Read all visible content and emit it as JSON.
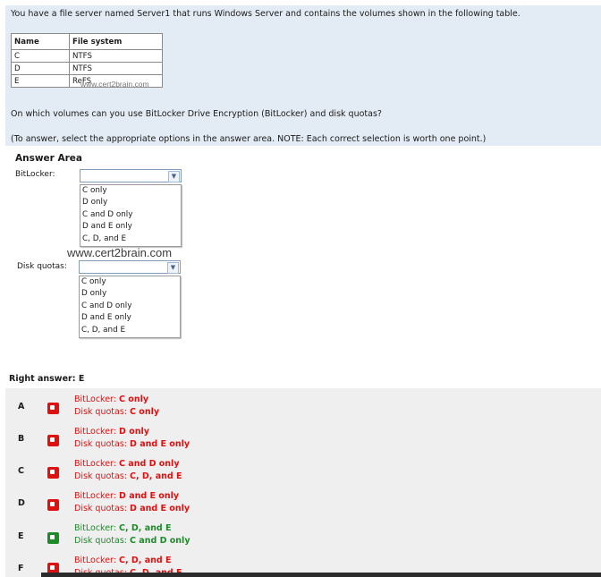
{
  "question": {
    "intro": "You have a file server named Server1 that runs Windows Server and contains the volumes shown in the following table.",
    "table": {
      "headers": [
        "Name",
        "File system"
      ],
      "rows": [
        [
          "C",
          "NTFS"
        ],
        [
          "D",
          "NTFS"
        ],
        [
          "E",
          "ReFS"
        ]
      ]
    },
    "watermark_small": "www.cert2brain.com",
    "prompt": "On which volumes can you use BitLocker Drive Encryption (BitLocker) and disk quotas?",
    "instructions": "(To answer, select the appropriate options in the answer area. NOTE: Each correct selection is worth one point.)"
  },
  "answer_area": {
    "title": "Answer Area",
    "bitlocker": {
      "label": "BitLocker:",
      "selected": "",
      "options": [
        "C only",
        "D only",
        "C and D only",
        "D and E only",
        "C, D, and E"
      ]
    },
    "watermark_big": "www.cert2brain.com",
    "disk_quotas": {
      "label": "Disk quotas:",
      "selected": "",
      "options": [
        "C only",
        "D only",
        "C and D only",
        "D and E only",
        "C, D, and E"
      ]
    }
  },
  "right_answer": "Right answer: E",
  "choices": [
    {
      "letter": "A",
      "status": "wrong",
      "bitlocker_label": "BitLocker: ",
      "bitlocker": "C only",
      "quotas_label": "Disk quotas: ",
      "quotas": "C only"
    },
    {
      "letter": "B",
      "status": "wrong",
      "bitlocker_label": "BitLocker: ",
      "bitlocker": "D only",
      "quotas_label": "Disk quotas: ",
      "quotas": "D and E only"
    },
    {
      "letter": "C",
      "status": "wrong",
      "bitlocker_label": "BitLocker: ",
      "bitlocker": "C and D only",
      "quotas_label": "Disk quotas: ",
      "quotas": "C, D, and E"
    },
    {
      "letter": "D",
      "status": "wrong",
      "bitlocker_label": "BitLocker: ",
      "bitlocker": "D and E only",
      "quotas_label": "Disk quotas: ",
      "quotas": "D and E only"
    },
    {
      "letter": "E",
      "status": "correct",
      "bitlocker_label": "BitLocker: ",
      "bitlocker": "C, D, and E",
      "quotas_label": "Disk quotas: ",
      "quotas": "C and D only"
    },
    {
      "letter": "F",
      "status": "wrong",
      "bitlocker_label": "BitLocker: ",
      "bitlocker": "C, D, and E",
      "quotas_label": "Disk quotas: ",
      "quotas": "C, D, and E"
    }
  ],
  "colors": {
    "wrong": "#e01010",
    "correct": "#1e8a2a",
    "question_bg": "#e3ecf5",
    "choices_bg": "#efefef"
  }
}
